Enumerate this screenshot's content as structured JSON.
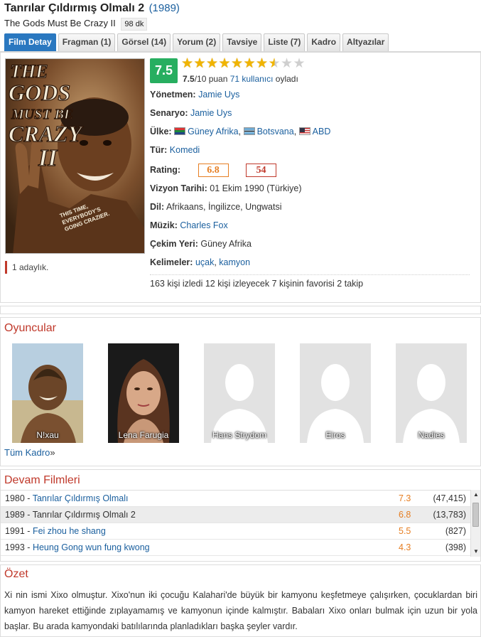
{
  "movie": {
    "title": "Tanrılar Çıldırmış Olmalı 2",
    "year": "(1989)",
    "original_title": "The Gods Must Be Crazy II",
    "duration": "98 dk"
  },
  "tabs": [
    {
      "label": "Film Detay",
      "active": true
    },
    {
      "label": "Fragman (1)"
    },
    {
      "label": "Görsel (14)"
    },
    {
      "label": "Yorum (2)"
    },
    {
      "label": "Tavsiye"
    },
    {
      "label": "Liste (7)"
    },
    {
      "label": "Kadro"
    },
    {
      "label": "Altyazılar"
    }
  ],
  "poster": {
    "line1": "THE",
    "line2": "GODS",
    "line3": "MUST BE",
    "line4": "CRAZY",
    "numeral": "II",
    "tagline1": "THIS TIME,",
    "tagline2": "EVERYBODY'S",
    "tagline3": "GOING CRAZIER."
  },
  "nominations": "1 adaylık.",
  "rating": {
    "score": "7.5",
    "stars_filled": 7.5,
    "stars_total": 10,
    "score_text": "7.5",
    "score_suffix": "/10 puan",
    "voters": "71 kullanıcı",
    "voted": "oyladı"
  },
  "details": {
    "director_label": "Yönetmen:",
    "director": "Jamie Uys",
    "writer_label": "Senaryo:",
    "writer": "Jamie Uys",
    "country_label": "Ülke:",
    "countries": [
      "Güney Afrika",
      "Botsvana",
      "ABD"
    ],
    "genre_label": "Tür:",
    "genre": "Komedi",
    "rating_label": "Rating:",
    "imdb_score": "6.8",
    "meta_score": "54",
    "release_label": "Vizyon Tarihi:",
    "release": "01 Ekim 1990 (Türkiye)",
    "language_label": "Dil:",
    "languages": "Afrikaans, İngilizce, Ungwatsi",
    "music_label": "Müzik:",
    "music": "Charles Fox",
    "location_label": "Çekim Yeri:",
    "location": "Güney Afrika",
    "keywords_label": "Kelimeler:",
    "keywords": [
      "uçak",
      "kamyon"
    ]
  },
  "stats": "163 kişi izledi 12 kişi izleyecek 7 kişinin favorisi 2 takip",
  "cast": {
    "title": "Oyuncular",
    "members": [
      "N!xau",
      "Lena Farugia",
      "Hans Strydom",
      "Eiros",
      "Nadies"
    ],
    "all_link": "Tüm Kadro",
    "all_arrow": "»"
  },
  "sequels": {
    "title": "Devam Filmleri",
    "items": [
      {
        "year": "1980 -",
        "title": "Tanrılar Çıldırmış Olmalı",
        "score": "7.3",
        "votes": "(47,415)",
        "link": true
      },
      {
        "year": "1989 -",
        "title": "Tanrılar Çıldırmış Olmalı 2",
        "score": "6.8",
        "votes": "(13,783)",
        "link": false
      },
      {
        "year": "1991 -",
        "title": "Fei zhou he shang",
        "score": "5.5",
        "votes": "(827)",
        "link": true
      },
      {
        "year": "1993 -",
        "title": "Heung Gong wun fung kwong",
        "score": "4.3",
        "votes": "(398)",
        "link": true
      }
    ]
  },
  "summary": {
    "title": "Özet",
    "text": "Xi nin ismi Xixo olmuştur. Xixo'nun iki çocuğu Kalahari'de büyük bir kamyonu keşfetmeye çalışırken, çocuklardan biri kamyon hareket ettiğinde zıplayamamış ve kamyonun içinde kalmıştır. Babaları Xixo onları bulmak için uzun bir yola başlar. Bu arada kamyondaki batılılarında planladıkları başka şeyler vardır."
  },
  "colors": {
    "accent_blue": "#2a78c0",
    "link": "#1a5f9e",
    "section_red": "#c0392b",
    "score_green": "#27ae60",
    "imdb_orange": "#e67e22"
  },
  "icons": [
    "star-icon",
    "flag-za-icon",
    "flag-bw-icon",
    "flag-us-icon",
    "scroll-up-icon",
    "scroll-down-icon",
    "person-placeholder-icon"
  ]
}
